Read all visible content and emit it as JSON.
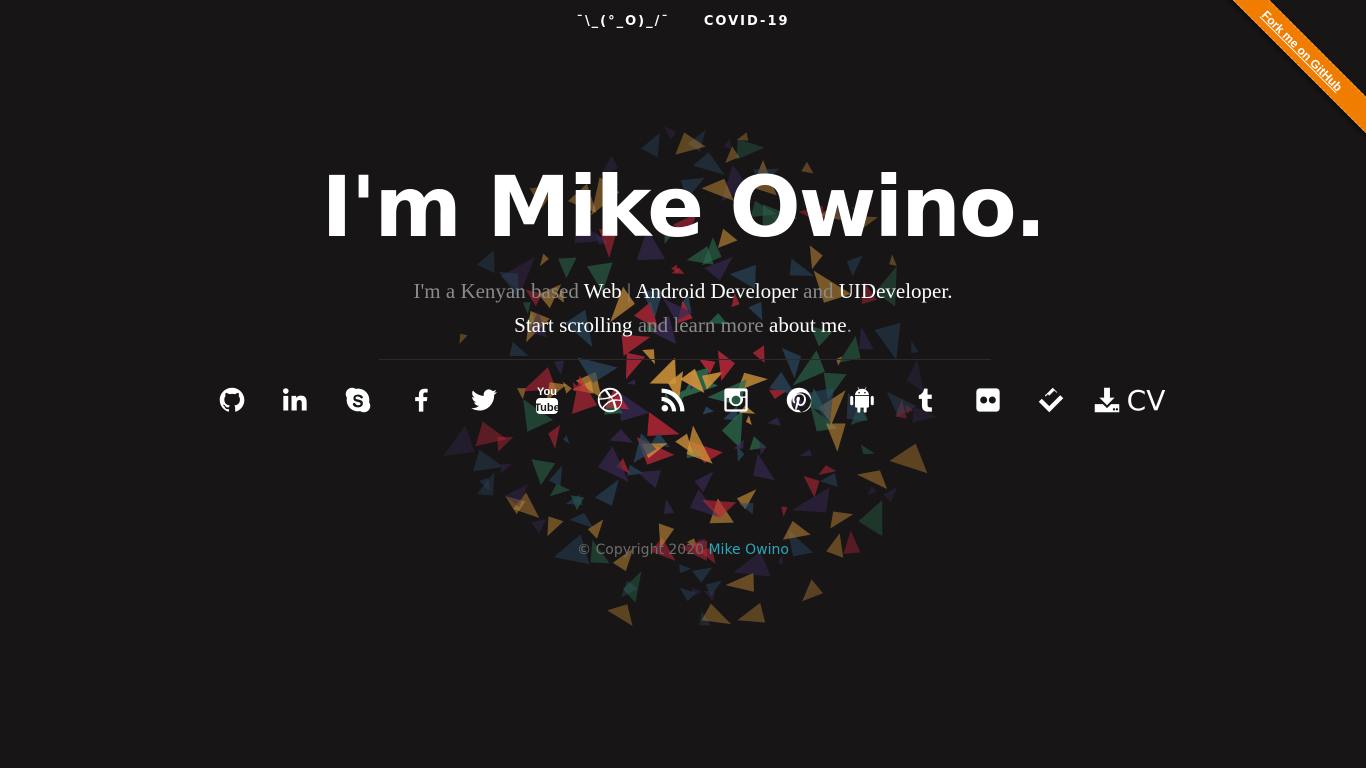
{
  "nav": {
    "items": [
      {
        "label": "¯\\_(°_O)_/¯"
      },
      {
        "label": "COVID-19"
      }
    ]
  },
  "ribbon": {
    "label": "Fork me on GitHub"
  },
  "hero": {
    "title": "I'm Mike Owino.",
    "line1": {
      "p1": "I'm a Kenyan based ",
      "web": "Web",
      "sep": " | ",
      "android": "Android Developer",
      "and": " and ",
      "ui": "UIDeveloper",
      "dot": "."
    },
    "line2": {
      "start": "Start scrolling",
      "mid": " and learn more ",
      "about": "about me",
      "dot": "."
    }
  },
  "social": [
    {
      "icon": "github-icon"
    },
    {
      "icon": "linkedin-icon"
    },
    {
      "icon": "skype-icon"
    },
    {
      "icon": "facebook-icon"
    },
    {
      "icon": "twitter-icon"
    },
    {
      "icon": "youtube-icon"
    },
    {
      "icon": "dribbble-icon"
    },
    {
      "icon": "rss-icon"
    },
    {
      "icon": "instagram-icon"
    },
    {
      "icon": "pinterest-icon"
    },
    {
      "icon": "android-icon"
    },
    {
      "icon": "tumblr-icon"
    },
    {
      "icon": "flickr-icon"
    },
    {
      "icon": "foursquare-icon"
    },
    {
      "icon": "download-icon",
      "label": "CV"
    }
  ],
  "footer": {
    "copyright": "© Copyright 2020 ",
    "name": "Mike Owino"
  },
  "colors": {
    "background": "#171516",
    "ribbon": "#f07c00",
    "footer_link": "#2aa7b8",
    "shards": [
      "#d4953a",
      "#c0283a",
      "#2c6b4e",
      "#3a2a55",
      "#2b4a63"
    ]
  }
}
